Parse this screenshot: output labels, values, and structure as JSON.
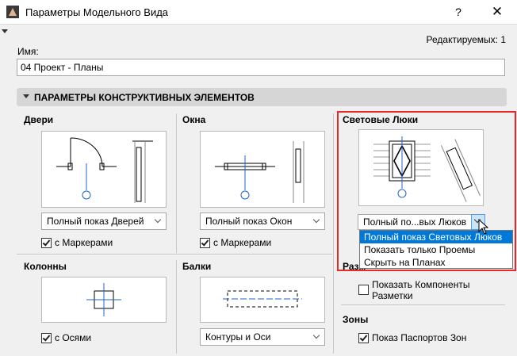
{
  "window": {
    "title": "Параметры Модельного Вида",
    "help": "?",
    "close": "✕"
  },
  "edit_count": "Редактируемых: 1",
  "name": {
    "label": "Имя:",
    "value": "04 Проект - Планы"
  },
  "section": {
    "title": "ПАРАМЕТРЫ КОНСТРУКТИВНЫХ ЭЛЕМЕНТОВ"
  },
  "doors": {
    "title": "Двери",
    "option": "Полный показ Дверей",
    "checkbox_label": "с Маркерами",
    "checked": true
  },
  "windows": {
    "title": "Окна",
    "option": "Полный показ Окон",
    "checkbox_label": "с Маркерами",
    "checked": true
  },
  "skylights": {
    "title": "Световые Люки",
    "option": "Полный по...вых Люков",
    "options": [
      "Полный показ Световых Люков",
      "Показать только Проемы",
      "Скрыть на Планах"
    ],
    "highlighted_option": "Полный показ Световых Люков"
  },
  "columns": {
    "title": "Колонны",
    "checkbox_label": "с Осями",
    "checked": true
  },
  "beams": {
    "title": "Балки",
    "option": "Контуры и Оси"
  },
  "markup": {
    "title_partial": "Разм",
    "checkbox_label": "Показать Компоненты Разметки",
    "checked": false
  },
  "zones": {
    "title": "Зоны",
    "checkbox_label": "Показ Паспортов Зон",
    "checked": true
  },
  "colors": {
    "highlight_border": "#e8282b",
    "selected_item": "#0078d7",
    "symbol_blue": "#1e64c8"
  }
}
